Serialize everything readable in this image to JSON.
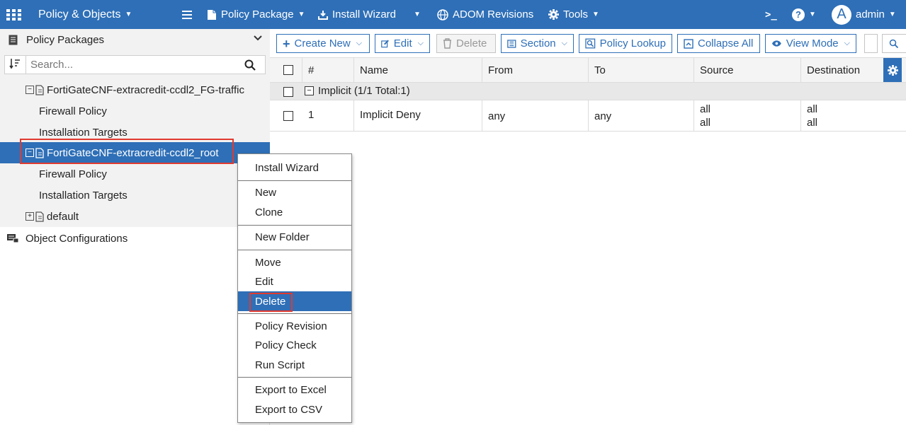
{
  "topbar": {
    "title": "Policy & Objects",
    "policy_package": "Policy Package",
    "install_wizard": "Install Wizard",
    "adom_revisions": "ADOM Revisions",
    "tools": "Tools",
    "console": ">_",
    "help": "?",
    "avatar_letter": "A",
    "user": "admin"
  },
  "sidebar": {
    "header": "Policy Packages",
    "search_placeholder": "Search...",
    "tree": [
      {
        "label": "FortiGateCNF-extracredit-ccdl2_FG-traffic",
        "toggle": "−"
      },
      {
        "label": "Firewall Policy"
      },
      {
        "label": "Installation Targets"
      },
      {
        "label": "FortiGateCNF-extracredit-ccdl2_root",
        "toggle": "−"
      },
      {
        "label": "Firewall Policy"
      },
      {
        "label": "Installation Targets"
      },
      {
        "label": "default",
        "toggle": "+"
      }
    ],
    "object_configurations": "Object Configurations"
  },
  "toolbar": {
    "create_new": "Create New",
    "edit": "Edit",
    "delete": "Delete",
    "section": "Section",
    "policy_lookup": "Policy Lookup",
    "collapse_all": "Collapse All",
    "view_mode": "View Mode"
  },
  "table": {
    "columns": [
      "#",
      "Name",
      "From",
      "To",
      "Source",
      "Destination"
    ],
    "group": {
      "toggle": "−",
      "label": "Implicit (1/1 Total:1)"
    },
    "rows": [
      {
        "num": "1",
        "name": "Implicit Deny",
        "from": "any",
        "to": "any",
        "source": [
          "all",
          "all"
        ],
        "destination": [
          "all",
          "all"
        ]
      }
    ]
  },
  "context_menu": {
    "items": [
      "Install Wizard",
      "New",
      "Clone",
      "New Folder",
      "Move",
      "Edit",
      "Delete",
      "Policy Revision",
      "Policy Check",
      "Run Script",
      "Export to Excel",
      "Export to CSV"
    ],
    "active_index": 6
  },
  "colors": {
    "brand": "#2e6fb7",
    "highlight_box": "#e03a2f"
  }
}
